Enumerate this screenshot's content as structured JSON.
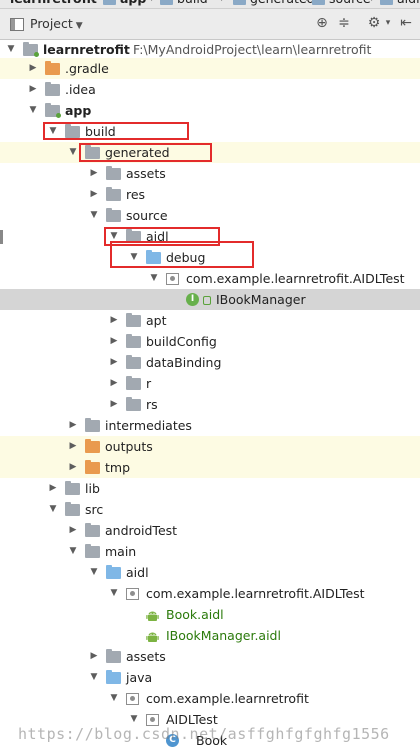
{
  "breadcrumbs": [
    "learnretrofit",
    "app",
    "build",
    "generated",
    "source",
    "aidl"
  ],
  "toolbar": {
    "view_label": "Project",
    "icons": [
      "target-icon",
      "collapse-icon",
      "gear-icon",
      "hide-icon"
    ]
  },
  "tree": [
    {
      "label": "learnretrofit",
      "extra": "F:\\MyAndroidProject\\learn\\learnretrofit",
      "icon": "module-folder-icon",
      "expanded": true,
      "bold": true
    },
    {
      "label": ".gradle",
      "icon": "folder-orange-icon",
      "expanded": false
    },
    {
      "label": ".idea",
      "icon": "folder-gray-icon",
      "expanded": false
    },
    {
      "label": "app",
      "icon": "module-folder-icon",
      "expanded": true,
      "bold": true
    },
    {
      "label": "build",
      "icon": "folder-gray-icon",
      "expanded": true
    },
    {
      "label": "generated",
      "icon": "folder-gray-icon",
      "expanded": true
    },
    {
      "label": "assets",
      "icon": "folder-gray-icon",
      "expanded": false
    },
    {
      "label": "res",
      "icon": "folder-gray-icon",
      "expanded": false
    },
    {
      "label": "source",
      "icon": "folder-gray-icon",
      "expanded": true
    },
    {
      "label": "aidl",
      "icon": "folder-gray-icon",
      "expanded": true
    },
    {
      "label": "debug",
      "icon": "source-folder-icon",
      "expanded": true
    },
    {
      "label": "com.example.learnretrofit.AIDLTest",
      "icon": "package-icon",
      "expanded": true
    },
    {
      "label": "IBookManager",
      "icon": "interface-icon",
      "selected": true
    },
    {
      "label": "apt",
      "icon": "folder-gray-icon",
      "expanded": false
    },
    {
      "label": "buildConfig",
      "icon": "folder-gray-icon",
      "expanded": false
    },
    {
      "label": "dataBinding",
      "icon": "folder-gray-icon",
      "expanded": false
    },
    {
      "label": "r",
      "icon": "folder-gray-icon",
      "expanded": false
    },
    {
      "label": "rs",
      "icon": "folder-gray-icon",
      "expanded": false
    },
    {
      "label": "intermediates",
      "icon": "folder-gray-icon",
      "expanded": false
    },
    {
      "label": "outputs",
      "icon": "folder-orange-icon",
      "expanded": false
    },
    {
      "label": "tmp",
      "icon": "folder-orange-icon",
      "expanded": false
    },
    {
      "label": "lib",
      "icon": "folder-gray-icon",
      "expanded": false
    },
    {
      "label": "src",
      "icon": "folder-gray-icon",
      "expanded": true
    },
    {
      "label": "androidTest",
      "icon": "folder-gray-icon",
      "expanded": false
    },
    {
      "label": "main",
      "icon": "folder-gray-icon",
      "expanded": true
    },
    {
      "label": "aidl",
      "icon": "folder-blue-icon",
      "expanded": true
    },
    {
      "label": "com.example.learnretrofit.AIDLTest",
      "icon": "package-icon",
      "expanded": true
    },
    {
      "label": "Book.aidl",
      "icon": "android-icon",
      "green": true
    },
    {
      "label": "IBookManager.aidl",
      "icon": "android-icon",
      "green": true
    },
    {
      "label": "assets",
      "icon": "assets-folder-icon",
      "expanded": false
    },
    {
      "label": "java",
      "icon": "folder-blue-icon",
      "expanded": true
    },
    {
      "label": "com.example.learnretrofit",
      "icon": "package-icon",
      "expanded": true
    },
    {
      "label": "AIDLTest",
      "icon": "package-icon",
      "expanded": true
    },
    {
      "label": "Book",
      "icon": "class-icon"
    }
  ],
  "watermark": "https://blog.csdn.net/asffghfgfghfg1556"
}
